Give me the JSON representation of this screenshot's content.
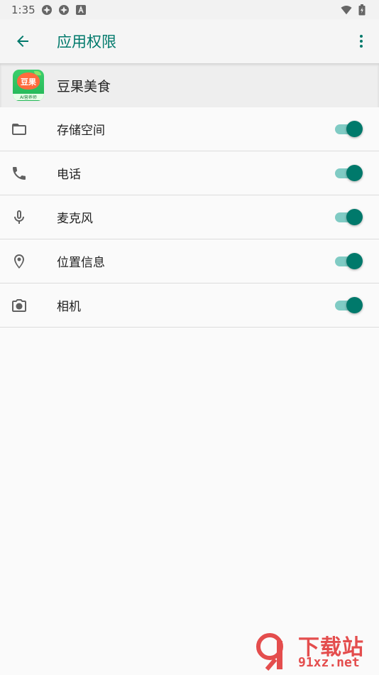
{
  "status_bar": {
    "time": "1:35",
    "left_icons": [
      "pinwheel-icon",
      "pinwheel-icon",
      "a-icon"
    ],
    "right_icons": [
      "wifi-icon",
      "battery-icon"
    ]
  },
  "app_bar": {
    "title": "应用权限",
    "accent_color": "#00796b"
  },
  "app_header": {
    "name": "豆果美食",
    "icon_text": "豆果",
    "icon_subtext": "AI营养师"
  },
  "permissions": [
    {
      "label": "存储空间",
      "icon": "folder-icon",
      "enabled": true
    },
    {
      "label": "电话",
      "icon": "phone-icon",
      "enabled": true
    },
    {
      "label": "麦克风",
      "icon": "microphone-icon",
      "enabled": true
    },
    {
      "label": "位置信息",
      "icon": "location-icon",
      "enabled": true
    },
    {
      "label": "相机",
      "icon": "camera-icon",
      "enabled": true
    }
  ],
  "watermark": {
    "title": "下载站",
    "url": "91xz.net"
  }
}
